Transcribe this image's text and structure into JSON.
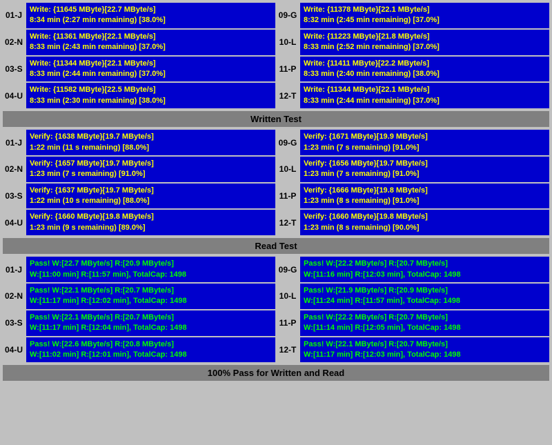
{
  "sections": {
    "write_test": {
      "label": "Written Test",
      "rows": [
        {
          "id": "01-J",
          "left_line1": "Write: {11645 MByte}[22.7 MByte/s]",
          "left_line2": "8:34 min (2:27 min remaining)  [38.0%]",
          "right_id": "09-G",
          "right_line1": "Write: {11378 MByte}[22.1 MByte/s]",
          "right_line2": "8:32 min (2:45 min remaining)  [37.0%]"
        },
        {
          "id": "02-N",
          "left_line1": "Write: {11361 MByte}[22.1 MByte/s]",
          "left_line2": "8:33 min (2:43 min remaining)  [37.0%]",
          "right_id": "10-L",
          "right_line1": "Write: {11223 MByte}[21.8 MByte/s]",
          "right_line2": "8:33 min (2:52 min remaining)  [37.0%]"
        },
        {
          "id": "03-S",
          "left_line1": "Write: {11344 MByte}[22.1 MByte/s]",
          "left_line2": "8:33 min (2:44 min remaining)  [37.0%]",
          "right_id": "11-P",
          "right_line1": "Write: {11411 MByte}[22.2 MByte/s]",
          "right_line2": "8:33 min (2:40 min remaining)  [38.0%]"
        },
        {
          "id": "04-U",
          "left_line1": "Write: {11582 MByte}[22.5 MByte/s]",
          "left_line2": "8:33 min (2:30 min remaining)  [38.0%]",
          "right_id": "12-T",
          "right_line1": "Write: {11344 MByte}[22.1 MByte/s]",
          "right_line2": "8:33 min (2:44 min remaining)  [37.0%]"
        }
      ]
    },
    "verify_test": {
      "label": "Written Test",
      "rows": [
        {
          "id": "01-J",
          "left_line1": "Verify: {1638 MByte}[19.7 MByte/s]",
          "left_line2": "1:22 min (11 s remaining)   [88.0%]",
          "right_id": "09-G",
          "right_line1": "Verify: {1671 MByte}[19.9 MByte/s]",
          "right_line2": "1:23 min (7 s remaining)   [91.0%]"
        },
        {
          "id": "02-N",
          "left_line1": "Verify: {1657 MByte}[19.7 MByte/s]",
          "left_line2": "1:23 min (7 s remaining)   [91.0%]",
          "right_id": "10-L",
          "right_line1": "Verify: {1656 MByte}[19.7 MByte/s]",
          "right_line2": "1:23 min (7 s remaining)   [91.0%]"
        },
        {
          "id": "03-S",
          "left_line1": "Verify: {1637 MByte}[19.7 MByte/s]",
          "left_line2": "1:22 min (10 s remaining)   [88.0%]",
          "right_id": "11-P",
          "right_line1": "Verify: {1666 MByte}[19.8 MByte/s]",
          "right_line2": "1:23 min (8 s remaining)   [91.0%]"
        },
        {
          "id": "04-U",
          "left_line1": "Verify: {1660 MByte}[19.8 MByte/s]",
          "left_line2": "1:23 min (9 s remaining)   [89.0%]",
          "right_id": "12-T",
          "right_line1": "Verify: {1660 MByte}[19.8 MByte/s]",
          "right_line2": "1:23 min (8 s remaining)   [90.0%]"
        }
      ]
    },
    "read_test": {
      "label": "Read Test",
      "rows": [
        {
          "id": "01-J",
          "left_line1": "Pass! W:[22.7 MByte/s] R:[20.9 MByte/s]",
          "left_line2": "W:[11:00 min] R:[11:57 min], TotalCap: 1498",
          "right_id": "09-G",
          "right_line1": "Pass! W:[22.2 MByte/s] R:[20.7 MByte/s]",
          "right_line2": "W:[11:16 min] R:[12:03 min], TotalCap: 1498"
        },
        {
          "id": "02-N",
          "left_line1": "Pass! W:[22.1 MByte/s] R:[20.7 MByte/s]",
          "left_line2": "W:[11:17 min] R:[12:02 min], TotalCap: 1498",
          "right_id": "10-L",
          "right_line1": "Pass! W:[21.9 MByte/s] R:[20.9 MByte/s]",
          "right_line2": "W:[11:24 min] R:[11:57 min], TotalCap: 1498"
        },
        {
          "id": "03-S",
          "left_line1": "Pass! W:[22.1 MByte/s] R:[20.7 MByte/s]",
          "left_line2": "W:[11:17 min] R:[12:04 min], TotalCap: 1498",
          "right_id": "11-P",
          "right_line1": "Pass! W:[22.2 MByte/s] R:[20.7 MByte/s]",
          "right_line2": "W:[11:14 min] R:[12:05 min], TotalCap: 1498"
        },
        {
          "id": "04-U",
          "left_line1": "Pass! W:[22.6 MByte/s] R:[20.8 MByte/s]",
          "left_line2": "W:[11:02 min] R:[12:01 min], TotalCap: 1498",
          "right_id": "12-T",
          "right_line1": "Pass! W:[22.1 MByte/s] R:[20.7 MByte/s]",
          "right_line2": "W:[11:17 min] R:[12:03 min], TotalCap: 1498"
        }
      ]
    }
  },
  "footer": "100% Pass for Written and Read",
  "section_headers": {
    "written": "Written Test",
    "read": "Read Test"
  }
}
